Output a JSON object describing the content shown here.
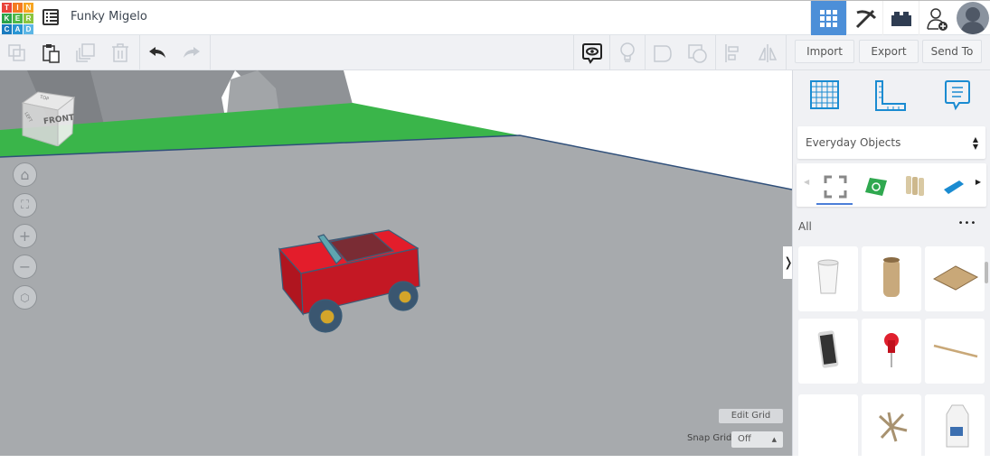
{
  "app": {
    "logo_letters": [
      "T",
      "I",
      "N",
      "K",
      "E",
      "R",
      "C",
      "A",
      "D"
    ],
    "logo_colors": [
      "#e9443b",
      "#f47b20",
      "#f7a521",
      "#2aa34a",
      "#4fb848",
      "#8bc53f",
      "#1a7bbf",
      "#2995d3",
      "#5cb6e5"
    ],
    "title": "Funky Migelo"
  },
  "header": {
    "icons": [
      "grid-view-icon",
      "pickaxe-icon",
      "brick-icon",
      "add-user-icon",
      "avatar"
    ],
    "active_color": "#4c8fd8"
  },
  "toolbar": {
    "import": "Import",
    "export": "Export",
    "send_to": "Send To"
  },
  "viewcube": {
    "front": "FRONT",
    "top": "TOP",
    "left": "LEFT"
  },
  "grid": {
    "edit_grid": "Edit Grid",
    "snap_grid_label": "Snap Grid",
    "snap_grid_value": "Off"
  },
  "panel": {
    "category": "Everyday Objects",
    "filter": "All",
    "more": "•••",
    "toggle": "❭"
  },
  "colors": {
    "ground": "#a7aaad",
    "plane_border": "#3ab54a",
    "car": "#d81f2c",
    "accent": "#1a8bd1"
  }
}
